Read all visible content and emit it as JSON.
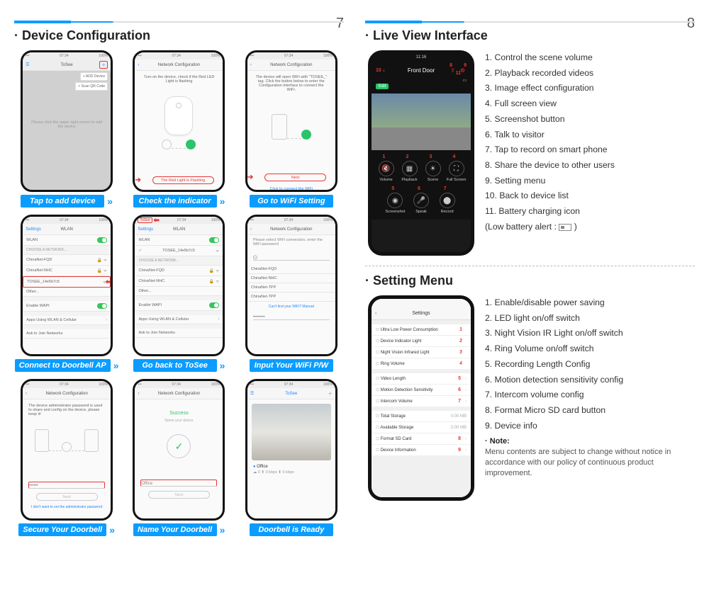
{
  "pages": {
    "left": "7",
    "right": "8"
  },
  "left": {
    "title": "Device Configuration",
    "cells": [
      {
        "header": "ToSee",
        "caption": "Tap to add device",
        "menu1": "+ ADD Device",
        "menu2": "+ Scan QR Code",
        "hint": "Please click the upper right corner to add the device"
      },
      {
        "header": "Network Configuration",
        "caption": "Check the indicator",
        "text": "Turn on the device, check if the Red LED Light is flashing",
        "btn": "The Red Light is Flashing"
      },
      {
        "header": "Network Configuration",
        "caption": "Go to WiFi Setting",
        "text": "The device will open WiFi with \"TOSEE_\" tag. Click the button below to enter the Configuration interface to connect the WiFi.",
        "btn": "Next",
        "foot": "Click to connect the WiFi"
      },
      {
        "header": "WLAN",
        "caption": "Connect to Doorbell AP",
        "settings": "Settings",
        "wlan": "WLAN",
        "choose": "CHOOSE A NETWORK...",
        "n1": "ChinaNet-FQD",
        "n2": "ChinaNet-NHC",
        "sel": "TOSEE_14e5b7c5",
        "n3": "Other...",
        "wapi": "Enable WAPI",
        "apps": "Apps Using WLAN & Cellular",
        "ask": "Ask to Join Networks"
      },
      {
        "header": "WLAN",
        "caption": "Go back to ToSee",
        "settings": "Settings",
        "tosee": "ToSee",
        "wlan": "WLAN",
        "sel": "TOSEE_14e5b7c5",
        "choose": "CHOOSE A NETWORK...",
        "n1": "ChinaNet-FQD",
        "n2": "ChinaNet-NHC",
        "n3": "Other...",
        "wapi": "Enable WAPI",
        "apps": "Apps Using WLAN & Cellular",
        "ask": "Ask to Join Networks"
      },
      {
        "header": "Network Configuration",
        "caption": "Input Your WiFi P/W",
        "text": "Please select WiFi connection, enter the WiFi password",
        "n1": "ChinaNet-FQD",
        "n2": "ChinaNet-NHC",
        "n3": "ChinaNet-TPP",
        "n4": "ChinaNet-TPP",
        "foot": "Can't find your WiFi? Manual"
      },
      {
        "header": "Network Configuration",
        "caption": "Secure Your Doorbell",
        "text": "The device administrator password is used to share and config on the device, please keep it!",
        "btn": "Next",
        "link": "I don't want to set the administrator password"
      },
      {
        "header": "Network Configuration",
        "caption": "Name Your Doorbell",
        "succ": "Success",
        "sub": "Name your device",
        "value": "Office",
        "btn": "Next"
      },
      {
        "header": "ToSee",
        "caption": "Doorbell is Ready",
        "dev": "Office",
        "stats": "☁ 0  ⬆ 0 kbps  ⬇ 0 kbps"
      }
    ]
  },
  "right": {
    "live": {
      "title": "Live View Interface",
      "phone": {
        "time": "11:16",
        "header": "Front Door",
        "edit": "Edit",
        "labels": {
          "l10": "10",
          "l11": "11",
          "l8": "8",
          "l9": "9"
        },
        "btns1": [
          {
            "n": "1",
            "label": "Volume"
          },
          {
            "n": "2",
            "label": "Playback"
          },
          {
            "n": "3",
            "label": "Scene"
          },
          {
            "n": "4",
            "label": "Full Screen"
          }
        ],
        "btns2": [
          {
            "n": "5",
            "label": "Screenshot"
          },
          {
            "n": "6",
            "label": "Speak"
          },
          {
            "n": "7",
            "label": "Record"
          }
        ]
      },
      "list": [
        "1. Control the scene volume",
        "2. Playback recorded videos",
        "3. Image effect configuration",
        "4. Full screen view",
        "5. Screenshot button",
        "6. Talk to visitor",
        "7. Tap to record  on smart phone",
        "8. Share the device to other users",
        "9. Setting menu",
        "10. Back to device list",
        "11. Battery charging icon"
      ],
      "lowbat_prefix": "  (Low battery alert : ",
      "lowbat_suffix": " )"
    },
    "settings": {
      "title": "Setting Menu",
      "phone": {
        "header": "Settings",
        "rows1": [
          {
            "n": "1",
            "label": "Ultra Low Power Consumption"
          },
          {
            "n": "2",
            "label": "Device Indicator Light"
          },
          {
            "n": "3",
            "label": "Night Vision Infrared Light"
          },
          {
            "n": "4",
            "label": "Ring Volume"
          }
        ],
        "rows2": [
          {
            "n": "5",
            "label": "Video Length"
          },
          {
            "n": "6",
            "label": "Motion Detection Sensitivity"
          },
          {
            "n": "7",
            "label": "Intercom Volume"
          }
        ],
        "rows3": [
          {
            "n": "",
            "label": "Total Storage",
            "val": "0.00 MB"
          },
          {
            "n": "",
            "label": "Available Storage",
            "val": "0.00 MB"
          },
          {
            "n": "8",
            "label": "Format SD Card"
          },
          {
            "n": "9",
            "label": "Device Information"
          }
        ]
      },
      "list": [
        "1. Enable/disable power saving",
        "2. LED light on/off switch",
        "3. Night Vision IR Light on/off switch",
        "4. Ring Volume on/off switch",
        "5. Recording Length Config",
        "6. Motion detection sensitivity config",
        "7. Intercom volume config",
        "8. Format Micro SD card button",
        "9. Device info"
      ],
      "note_title": "· Note:",
      "note_body": "Menu contents are subject to change without notice in accordance with our policy of continuous product improvement."
    }
  }
}
